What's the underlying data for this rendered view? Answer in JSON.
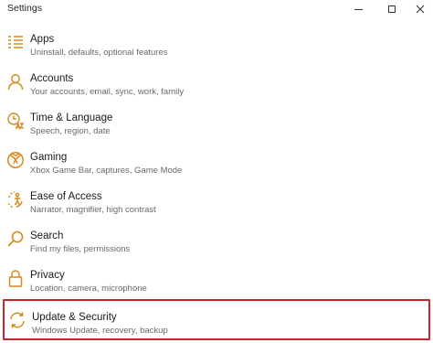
{
  "window": {
    "title": "Settings",
    "minimize_glyph": "—",
    "maximize_glyph": "☐",
    "close_glyph": "✕"
  },
  "accent_color": "#d68a1e",
  "highlight_color": "#c8262d",
  "items": [
    {
      "label": "Apps",
      "desc": "Uninstall, defaults, optional features",
      "icon": "apps-list-icon"
    },
    {
      "label": "Accounts",
      "desc": "Your accounts, email, sync, work, family",
      "icon": "person-icon"
    },
    {
      "label": "Time & Language",
      "desc": "Speech, region, date",
      "icon": "time-language-icon"
    },
    {
      "label": "Gaming",
      "desc": "Xbox Game Bar, captures, Game Mode",
      "icon": "xbox-icon"
    },
    {
      "label": "Ease of Access",
      "desc": "Narrator, magnifier, high contrast",
      "icon": "ease-of-access-icon"
    },
    {
      "label": "Search",
      "desc": "Find my files, permissions",
      "icon": "search-icon"
    },
    {
      "label": "Privacy",
      "desc": "Location, camera, microphone",
      "icon": "lock-icon"
    },
    {
      "label": "Update & Security",
      "desc": "Windows Update, recovery, backup",
      "icon": "sync-icon",
      "selected": true
    }
  ]
}
